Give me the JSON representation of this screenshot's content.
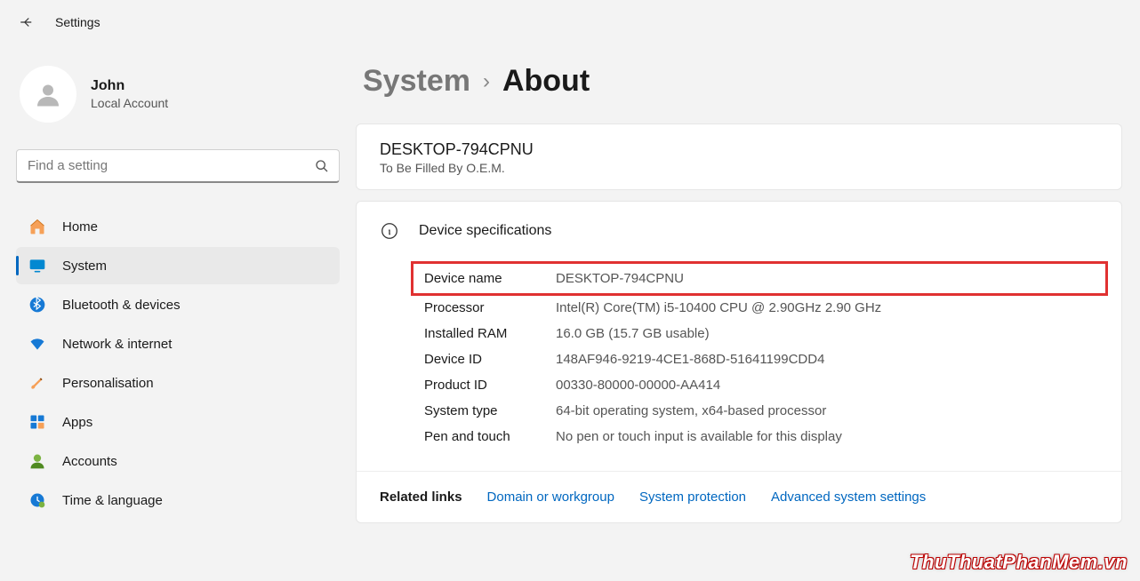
{
  "app_title": "Settings",
  "user": {
    "name": "John",
    "subtitle": "Local Account"
  },
  "search": {
    "placeholder": "Find a setting"
  },
  "nav": {
    "home": "Home",
    "system": "System",
    "bluetooth": "Bluetooth & devices",
    "network": "Network & internet",
    "personalisation": "Personalisation",
    "apps": "Apps",
    "accounts": "Accounts",
    "time": "Time & language"
  },
  "breadcrumb": {
    "parent": "System",
    "current": "About"
  },
  "device": {
    "name": "DESKTOP-794CPNU",
    "oem": "To Be Filled By O.E.M."
  },
  "spec_section_title": "Device specifications",
  "specs": {
    "device_name_label": "Device name",
    "device_name_value": "DESKTOP-794CPNU",
    "processor_label": "Processor",
    "processor_value": "Intel(R) Core(TM) i5-10400 CPU @ 2.90GHz   2.90 GHz",
    "ram_label": "Installed RAM",
    "ram_value": "16.0 GB (15.7 GB usable)",
    "device_id_label": "Device ID",
    "device_id_value": "148AF946-9219-4CE1-868D-51641199CDD4",
    "product_id_label": "Product ID",
    "product_id_value": "00330-80000-00000-AA414",
    "system_type_label": "System type",
    "system_type_value": "64-bit operating system, x64-based processor",
    "pen_label": "Pen and touch",
    "pen_value": "No pen or touch input is available for this display"
  },
  "related": {
    "label": "Related links",
    "domain": "Domain or workgroup",
    "protection": "System protection",
    "advanced": "Advanced system settings"
  },
  "watermark": "ThuThuatPhanMem.vn"
}
